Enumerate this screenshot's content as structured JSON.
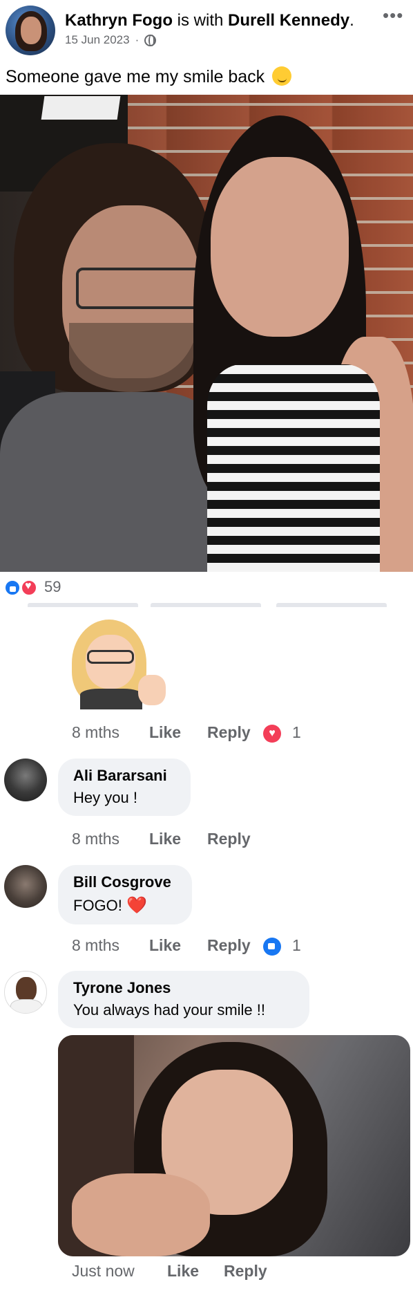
{
  "post": {
    "author": "Kathryn Fogo",
    "with_text": "is with",
    "tagged": "Durell Kennedy",
    "period": ".",
    "date": "15 Jun 2023",
    "dot": "·",
    "more": "•••",
    "text": "Someone gave me my smile back",
    "privacy_icon": "globe-icon"
  },
  "reactions": {
    "count": "59",
    "icons": [
      "like-icon",
      "love-icon"
    ]
  },
  "comments": [
    {
      "type": "sticker",
      "time": "8 mths",
      "like_label": "Like",
      "reply_label": "Reply",
      "reaction_count": "1",
      "reaction_icon": "love-icon"
    },
    {
      "author": "Ali Bararsani",
      "text": "Hey you !",
      "time": "8 mths",
      "like_label": "Like",
      "reply_label": "Reply"
    },
    {
      "author": "Bill Cosgrove",
      "text": "FOGO!",
      "emoji": "❤️",
      "time": "8 mths",
      "like_label": "Like",
      "reply_label": "Reply",
      "reaction_count": "1",
      "reaction_icon": "like-icon"
    },
    {
      "author": "Tyrone Jones",
      "text": "You always had your smile !!",
      "time": "Just now",
      "like_label": "Like",
      "reply_label": "Reply"
    }
  ],
  "colors": {
    "like_blue": "#1877f2",
    "love_red": "#f33e58",
    "meta_gray": "#65676b",
    "bubble_bg": "#f0f2f5"
  }
}
